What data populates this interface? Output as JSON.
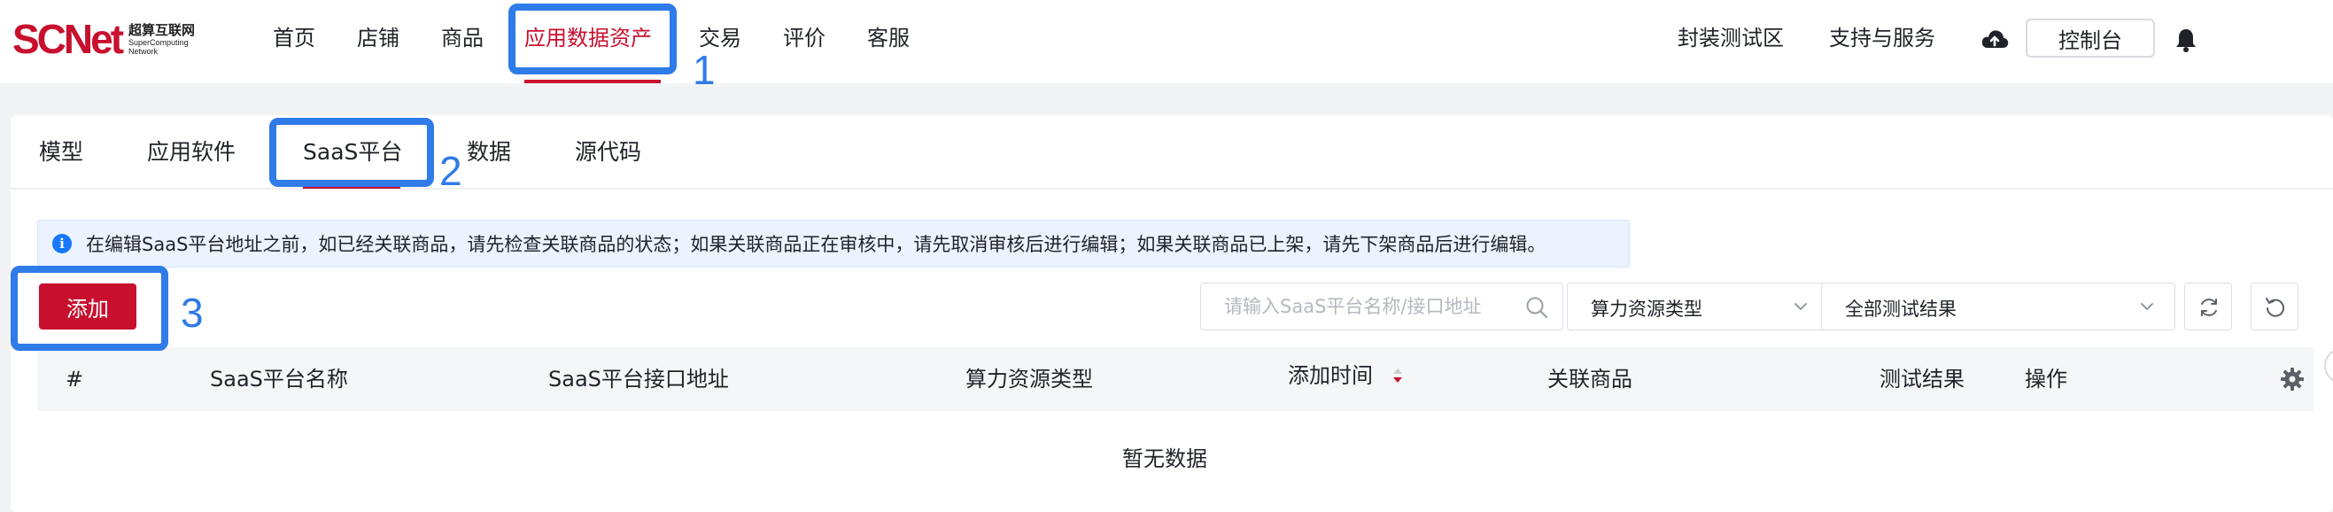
{
  "brand": {
    "logo_text": "SCNet",
    "name_cn": "超算互联网",
    "name_en_1": "SuperComputing",
    "name_en_2": "Network",
    "accent": "#c8102e"
  },
  "nav": {
    "items": [
      {
        "label": "首页"
      },
      {
        "label": "店铺"
      },
      {
        "label": "商品"
      },
      {
        "label": "应用数据资产",
        "active": true
      },
      {
        "label": "交易"
      },
      {
        "label": "评价"
      },
      {
        "label": "客服"
      }
    ],
    "right": {
      "test_zone": "封装测试区",
      "support": "支持与服务",
      "console": "控制台"
    }
  },
  "annotations": {
    "step1": "1",
    "step2": "2",
    "step3": "3",
    "color": "#2f7be8"
  },
  "tabs": [
    {
      "label": "模型"
    },
    {
      "label": "应用软件"
    },
    {
      "label": "SaaS平台",
      "active": true
    },
    {
      "label": "数据"
    },
    {
      "label": "源代码"
    }
  ],
  "notice": {
    "text": "在编辑SaaS平台地址之前，如已经关联商品，请先检查关联商品的状态；如果关联商品正在审核中，请先取消审核后进行编辑；如果关联商品已上架，请先下架商品后进行编辑。"
  },
  "toolbar": {
    "add_label": "添加",
    "search_placeholder": "请输入SaaS平台名称/接口地址",
    "resource_type": "算力资源类型",
    "test_result": "全部测试结果"
  },
  "table": {
    "columns": {
      "index": "#",
      "name": "SaaS平台名称",
      "api": "SaaS平台接口地址",
      "resource": "算力资源类型",
      "added_time": "添加时间",
      "product": "关联商品",
      "result": "测试结果",
      "actions": "操作"
    },
    "rows": [],
    "empty_text": "暂无数据"
  }
}
